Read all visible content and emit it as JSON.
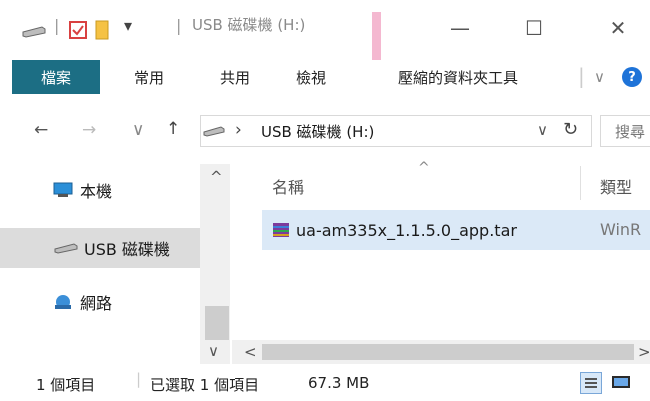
{
  "window": {
    "title": "USB 磁碟機 (H:)",
    "qat_dropdown_glyph": "▾",
    "minimize_glyph": "—",
    "maximize_glyph": "☐",
    "close_glyph": "✕"
  },
  "ribbon": {
    "tabs": [
      "檔案",
      "常用",
      "共用",
      "檢視",
      "壓縮的資料夾工具"
    ],
    "collapse_glyph": "∨",
    "help_glyph": "?"
  },
  "address": {
    "back_glyph": "←",
    "forward_glyph": "→",
    "recent_glyph": "∨",
    "up_glyph": "↑",
    "breadcrumb_sep": "›",
    "path": "USB 磁碟機 (H:)",
    "dropdown_glyph": "∨",
    "refresh_glyph": "↻",
    "search_placeholder": "搜尋"
  },
  "nav": {
    "items": [
      "本機",
      "USB 磁碟機",
      "網路"
    ],
    "scroll_up_glyph": "^",
    "scroll_down_glyph": "∨"
  },
  "content": {
    "sort_indicator": "^",
    "columns": [
      "名稱",
      "類型"
    ],
    "rows": [
      {
        "name": "ua-am335x_1.1.5.0_app.tar",
        "type": "WinR"
      }
    ],
    "scroll_left_glyph": "<",
    "scroll_right_glyph": ">"
  },
  "status": {
    "count": "1 個項目",
    "selected": "已選取 1 個項目",
    "size": "67.3 MB"
  },
  "colors": {
    "file_tab_bg": "#1c6e84",
    "selected_row": "#dbe9f7",
    "nav_selected": "#dcdcdc"
  }
}
